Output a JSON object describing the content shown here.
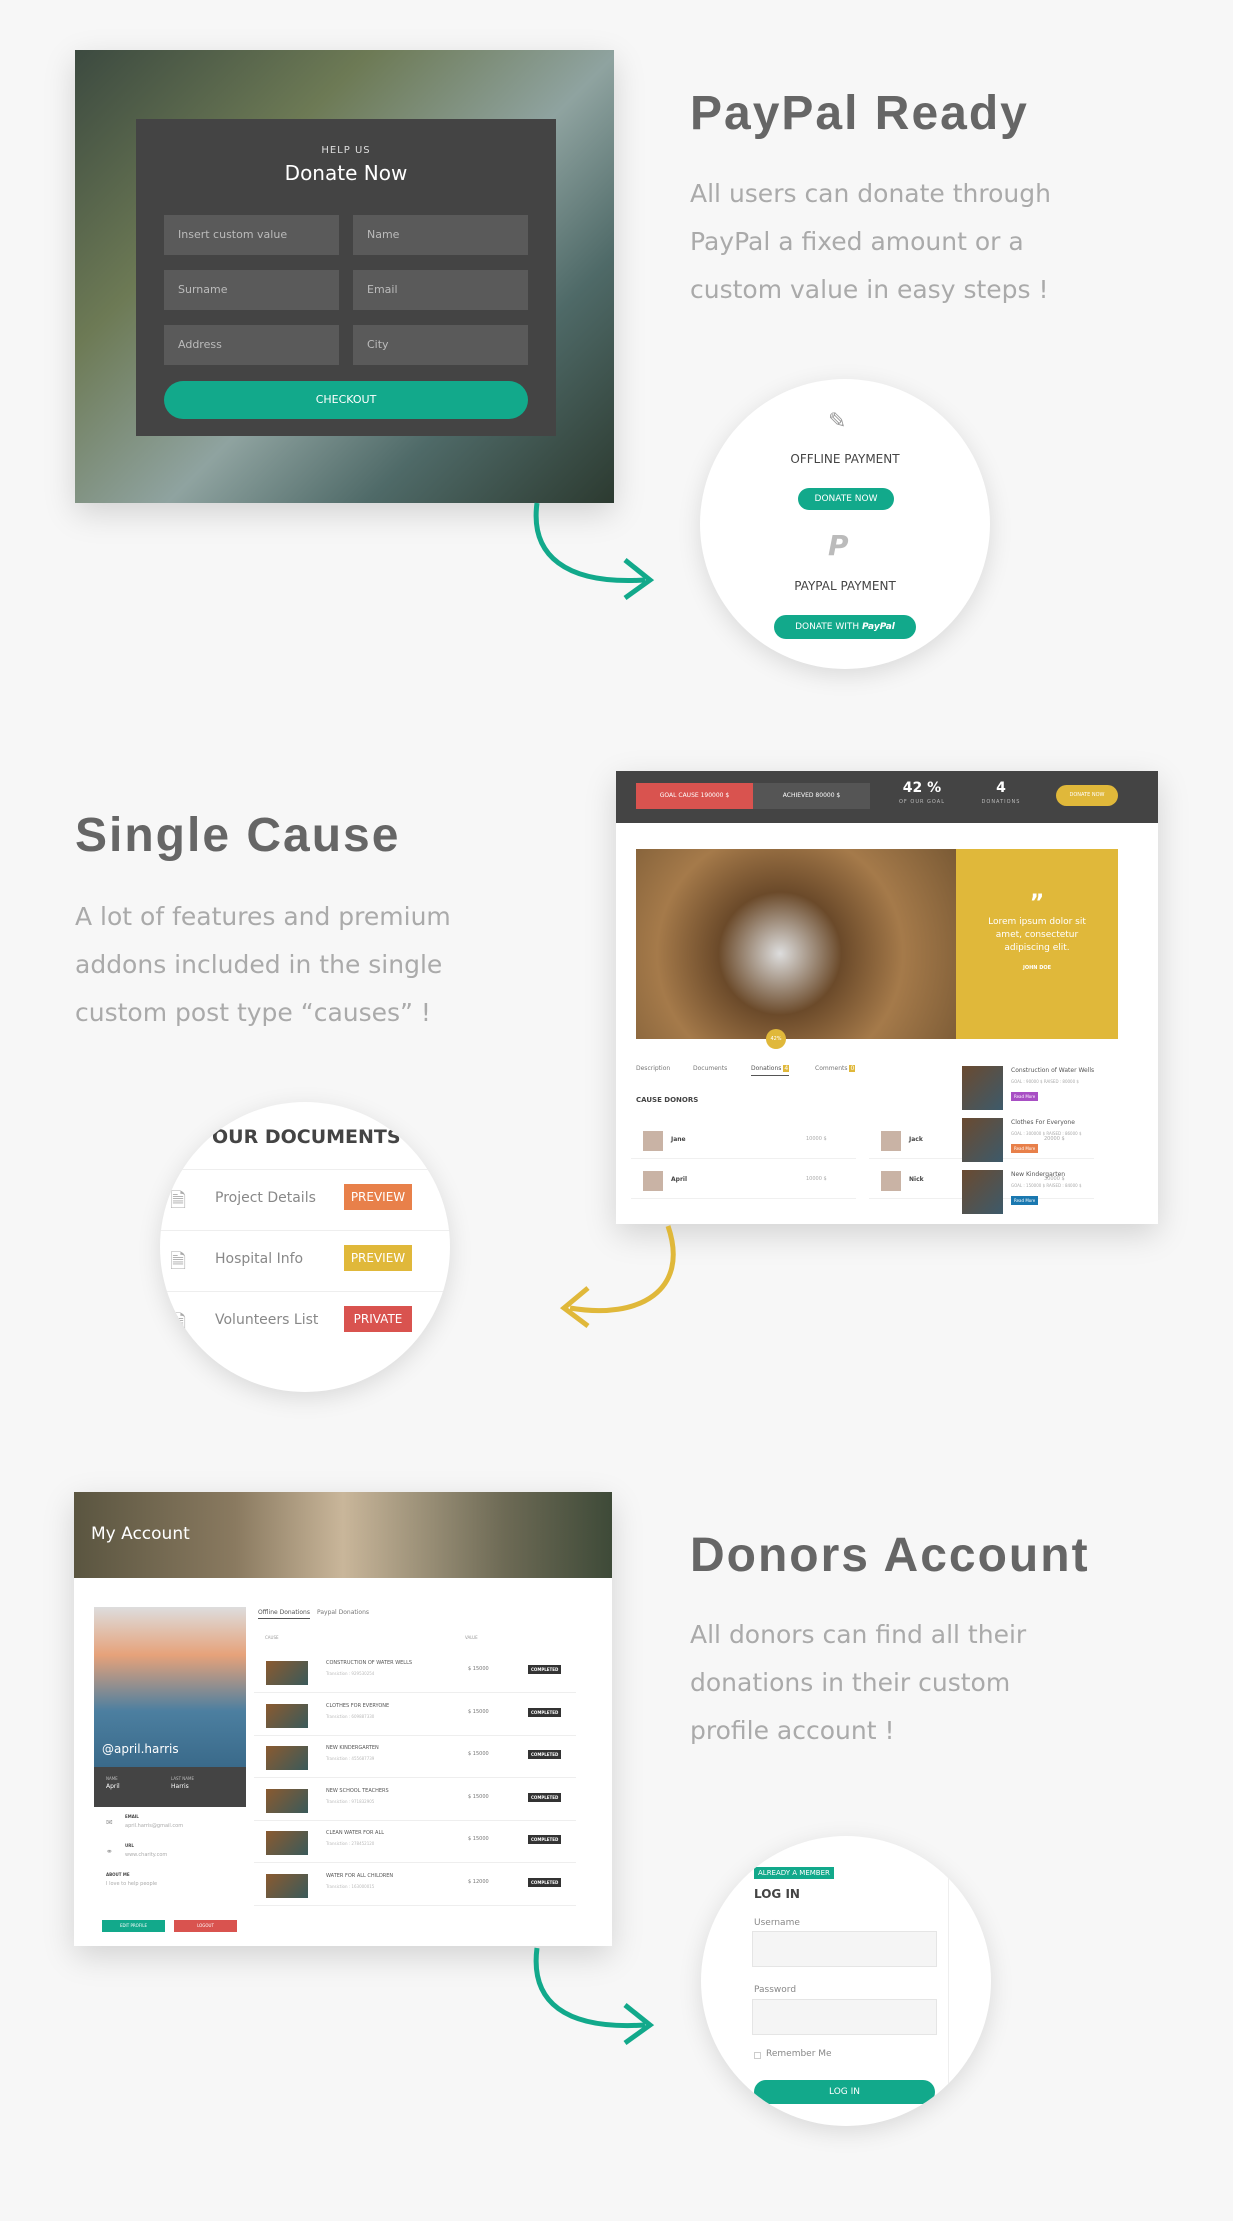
{
  "paypal": {
    "title": "PayPal Ready",
    "lines": [
      "All users can donate through",
      "PayPal a fixed amount or a",
      "custom value in easy steps !"
    ],
    "form": {
      "eyebrow": "HELP US",
      "title": "Donate Now",
      "fields": [
        "Insert custom value",
        "Name",
        "Surname",
        "Email",
        "Address",
        "City"
      ],
      "checkout": "CHECKOUT"
    },
    "circle": {
      "offline": "OFFLINE PAYMENT",
      "donate_now": "DONATE NOW",
      "paypal": "PAYPAL PAYMENT",
      "donate_with": "DONATE WITH",
      "paypal_brand": "PayPal"
    }
  },
  "cause": {
    "title": "Single Cause",
    "lines": [
      "A lot of features and premium",
      "addons included in the single",
      "custom post type “causes” !"
    ],
    "bar": {
      "goal": "GOAL CAUSE 190000 $",
      "achieved": "ACHIEVED 80000 $",
      "percent": "42 %",
      "percent_label": "OF OUR GOAL",
      "donations": "4",
      "donations_label": "DONATIONS",
      "donate": "DONATE NOW"
    },
    "quote": {
      "mark": "”",
      "text": "Lorem ipsum dolor sit amet, consectetur adipiscing elit.",
      "author": "JOHN DOE"
    },
    "badge": "42%",
    "tabs": [
      "Description",
      "Documents",
      "Donations",
      "Comments"
    ],
    "tab_counts": [
      "4",
      "0"
    ],
    "donors_title": "CAUSE DONORS",
    "donors": [
      {
        "name": "Jane",
        "amount": "10000 $"
      },
      {
        "name": "Jack",
        "amount": "20000 $"
      },
      {
        "name": "April",
        "amount": "10000 $"
      },
      {
        "name": "Nick",
        "amount": "30000 $"
      }
    ],
    "related": [
      {
        "title": "Construction of Water Wells",
        "meta": "GOAL : 90000 $   RAISED : 80000 $",
        "btn": "Read More",
        "color": "#a84fc4"
      },
      {
        "title": "Clothes For Everyone",
        "meta": "GOAL : 300000 $   RAISED : 86000 $",
        "btn": "Read More",
        "color": "#e8804a"
      },
      {
        "title": "New Kindergarten",
        "meta": "GOAL : 150000 $   RAISED : 84000 $",
        "btn": "Read More",
        "color": "#1a78b0"
      }
    ],
    "docs": {
      "title": "OUR DOCUMENTS",
      "items": [
        {
          "label": "Project Details",
          "btn": "PREVIEW",
          "color": "#e8804a"
        },
        {
          "label": "Hospital Info",
          "btn": "PREVIEW",
          "color": "#e0b83a"
        },
        {
          "label": "Volunteers List",
          "btn": "PRIVATE",
          "color": "#d9534f"
        }
      ]
    }
  },
  "account": {
    "title": "Donors Account",
    "lines": [
      "All donors can find all their",
      "donations in their custom",
      "profile account !"
    ],
    "header": "My Account",
    "handle": "@april.harris",
    "name_label": "NAME",
    "name": "April",
    "last_label": "LAST NAME",
    "last": "Harris",
    "email_label": "EMAIL",
    "email": "april.harris@gmail.com",
    "url_label": "URL",
    "url": "www.charity.com",
    "about_label": "ABOUT ME",
    "about": "I love to help people",
    "edit": "EDIT PROFILE",
    "logout": "LOGOUT",
    "tabs": [
      "Offline Donations",
      "Paypal Donations"
    ],
    "col_cause": "CAUSE",
    "col_value": "VALUE",
    "rows": [
      {
        "name": "CONSTRUCTION OF WATER WELLS",
        "tx": "Transiction : 929530254",
        "value": "$ 15000",
        "status": "COMPLETED"
      },
      {
        "name": "CLOTHES FOR EVERYONE",
        "tx": "Transiction : 609887330",
        "value": "$ 15000",
        "status": "COMPLETED"
      },
      {
        "name": "NEW KINDERGARTEN",
        "tx": "Transiction : 455687739",
        "value": "$ 15000",
        "status": "COMPLETED"
      },
      {
        "name": "NEW SCHOOL TEACHERS",
        "tx": "Transiction : 971832905",
        "value": "$ 15000",
        "status": "COMPLETED"
      },
      {
        "name": "CLEAN WATER FOR ALL",
        "tx": "Transiction : 278452120",
        "value": "$ 15000",
        "status": "COMPLETED"
      },
      {
        "name": "WATER FOR ALL CHILDREN",
        "tx": "Transiction : 163000015",
        "value": "$ 12000",
        "status": "COMPLETED"
      }
    ],
    "login": {
      "tag": "ALREADY A MEMBER",
      "title": "LOG IN",
      "username": "Username",
      "password": "Password",
      "remember": "Remember Me",
      "button": "LOG IN"
    }
  },
  "colors": {
    "teal": "#12a98b",
    "yellow": "#e0b83a",
    "red": "#d9534f",
    "dark": "#444444"
  }
}
